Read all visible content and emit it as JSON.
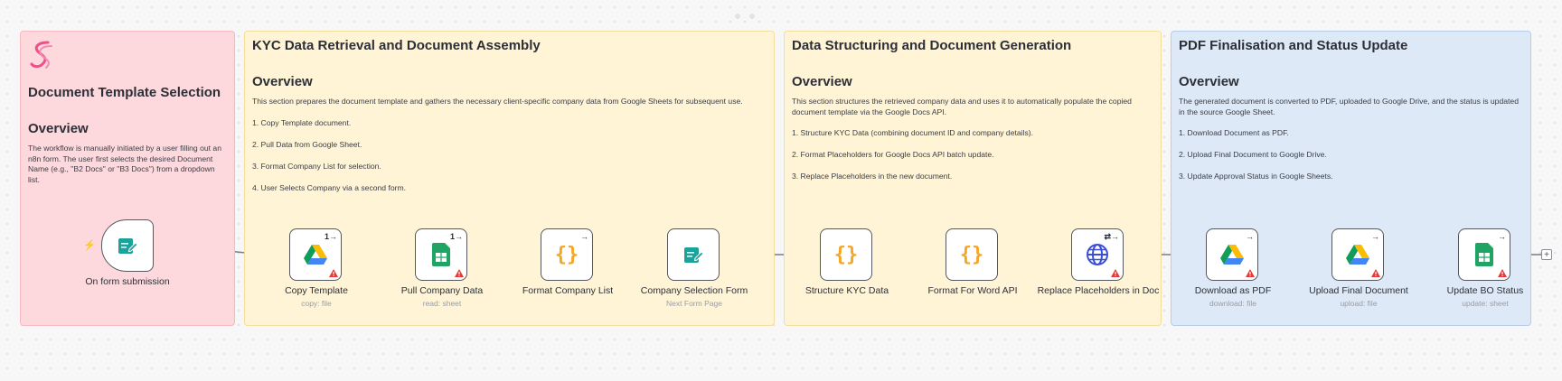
{
  "sections": [
    {
      "title": "Document Template Selection",
      "overview_title": "Overview",
      "overview_desc": "The workflow is manually initiated by a user filling out an n8n form. The user first selects the desired Document Name (e.g., \"B2 Docs\" or \"B3 Docs\") from a dropdown list.",
      "steps": []
    },
    {
      "title": "KYC Data Retrieval and Document Assembly",
      "overview_title": "Overview",
      "overview_desc": "This section prepares the document template and gathers the necessary client-specific company data from Google Sheets for subsequent use.",
      "steps": [
        "1. Copy Template document.",
        "2. Pull Data from Google Sheet.",
        "3. Format Company List for selection.",
        "4. User Selects Company via a second form."
      ]
    },
    {
      "title": "Data Structuring and Document Generation",
      "overview_title": "Overview",
      "overview_desc": "This section structures the retrieved company data and uses it to automatically populate the copied document template via the Google Docs API.",
      "steps": [
        "1. Structure KYC Data (combining document ID and company details).",
        "2. Format Placeholders for Google Docs API batch update.",
        "3. Replace Placeholders in the new document."
      ]
    },
    {
      "title": "PDF Finalisation and Status Update",
      "overview_title": "Overview",
      "overview_desc": "The generated document is converted to PDF, uploaded to Google Drive, and the status is updated in the source Google Sheet.",
      "steps": [
        "1. Download Document as PDF.",
        "2. Upload Final Document to Google Drive.",
        "3. Update Approval Status in Google Sheets."
      ]
    }
  ],
  "nodes": [
    {
      "label": "On form submission",
      "sub": "",
      "icon": "form-icon",
      "badge": ""
    },
    {
      "label": "Copy Template",
      "sub": "copy: file",
      "icon": "google-drive-icon",
      "badge": "1→"
    },
    {
      "label": "Pull Company Data",
      "sub": "read: sheet",
      "icon": "google-sheets-icon",
      "badge": "1→"
    },
    {
      "label": "Format Company List",
      "sub": "",
      "icon": "code-braces-icon",
      "badge": "→"
    },
    {
      "label": "Company Selection Form",
      "sub": "Next Form Page",
      "icon": "form-icon",
      "badge": ""
    },
    {
      "label": "Structure KYC Data",
      "sub": "",
      "icon": "code-braces-icon",
      "badge": ""
    },
    {
      "label": "Format For Word API",
      "sub": "",
      "icon": "code-braces-icon",
      "badge": ""
    },
    {
      "label": "Replace Placeholders in Doc",
      "sub": "",
      "icon": "globe-icon",
      "badge": "⇄→"
    },
    {
      "label": "Download as PDF",
      "sub": "download: file",
      "icon": "google-drive-icon",
      "badge": "→"
    },
    {
      "label": "Upload Final Document",
      "sub": "upload: file",
      "icon": "google-drive-icon",
      "badge": "→"
    },
    {
      "label": "Update BO Status",
      "sub": "update: sheet",
      "icon": "google-sheets-icon",
      "badge": "→"
    }
  ],
  "controls": {
    "add_label": "+",
    "trigger_marker": "⚡"
  },
  "colors": {
    "pink_bg": "#fdd9de",
    "yellow_bg": "#fff4d6",
    "blue_bg": "#dde9f7",
    "code_orange": "#f5a623",
    "form_teal": "#1aa39b",
    "sheets_green": "#1fa463",
    "warn_red": "#e53935"
  }
}
